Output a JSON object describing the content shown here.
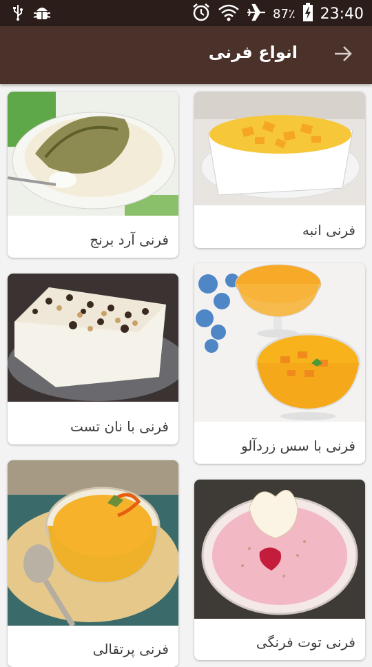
{
  "status_bar": {
    "battery": "87٪",
    "time": "23:40",
    "icons": [
      "usb-icon",
      "android-debug-icon",
      "alarm-icon",
      "wifi-icon",
      "airplane-icon",
      "battery-charging-icon"
    ]
  },
  "app_bar": {
    "title": "انواع فرنی",
    "back_icon": "arrow-right-icon"
  },
  "recipes": [
    {
      "label": "فرنی انبه"
    },
    {
      "label": "فرنی آرد برنج"
    },
    {
      "label": "فرنی با سس زردآلو"
    },
    {
      "label": "فرنی با نان تست"
    },
    {
      "label": "فرنی توت فرنگی"
    },
    {
      "label": "فرنی پرتقالی"
    }
  ],
  "colors": {
    "status_bar": "#2b1d19",
    "app_bar": "#4a3129",
    "background": "#f3f3f3",
    "card": "#ffffff"
  }
}
